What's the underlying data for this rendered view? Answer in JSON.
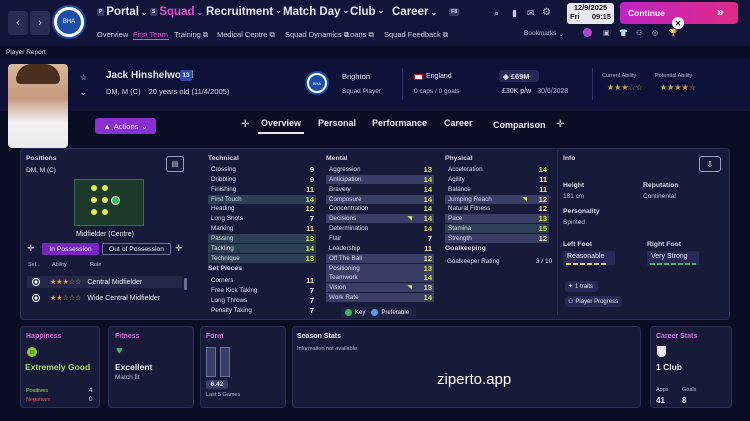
{
  "topbar": {
    "back": "‹",
    "forward": "›",
    "nav": [
      {
        "key": "P",
        "label": "Portal"
      },
      {
        "key": "S",
        "label": "Squad"
      },
      {
        "key": "",
        "label": "Recruitment"
      },
      {
        "key": "",
        "label": "Match Day"
      },
      {
        "key": "",
        "label": "Club"
      },
      {
        "key": "F8",
        "label": "Career"
      }
    ],
    "subnav": [
      "Overview",
      "First Team",
      "Training",
      "Medical Centre",
      "Squad Dynamics",
      "Loans",
      "Squad Feedback"
    ],
    "bookmarks": "Bookmarks",
    "date_line1": "12/9/2025",
    "date_day": "Fri",
    "date_time": "09:15",
    "continue_label": "Continue",
    "accent": "#d42aa8"
  },
  "breadcrumb": "Player Report",
  "player": {
    "name": "Jack Hinshelwood",
    "number": "13",
    "position": "DM, M (C)",
    "age": "20 years old (11/4/2005)",
    "club": "Brighton",
    "status": "Squad Player",
    "nation": "England",
    "caps": "0 caps / 0 goals",
    "value": "£69M",
    "wage": "£30K p/w",
    "contract": "30/6/2028",
    "current_ability_label": "Current Ability",
    "potential_ability_label": "Potential Ability",
    "current_stars": "★★★☆☆",
    "potential_stars": "★★★★☆"
  },
  "actions_label": "Actions",
  "tabs": [
    "Overview",
    "Personal",
    "Performance",
    "Career",
    "Comparison"
  ],
  "positions": {
    "title": "Positions",
    "value": "DM, M (C)",
    "pitch_caption": "Midfielder (Centre)",
    "btn_in": "In Possession",
    "btn_out": "Out of Possession",
    "col_sel": "Sel...",
    "col_ability": "Ability",
    "col_role": "Role",
    "roles": [
      {
        "stars": "★★★☆☆",
        "role": "Central Midfielder"
      },
      {
        "stars": "★★☆☆☆",
        "role": "Wide Central Midfielder"
      }
    ]
  },
  "technical": {
    "title": "Technical",
    "rows": [
      {
        "label": "Crossing",
        "value": "9"
      },
      {
        "label": "Dribbling",
        "value": "9"
      },
      {
        "label": "Finishing",
        "value": "11"
      },
      {
        "label": "First Touch",
        "value": "14"
      },
      {
        "label": "Heading",
        "value": "12"
      },
      {
        "label": "Long Shots",
        "value": "7"
      },
      {
        "label": "Marking",
        "value": "11"
      },
      {
        "label": "Passing",
        "value": "13"
      },
      {
        "label": "Tackling",
        "value": "14"
      },
      {
        "label": "Technique",
        "value": "13"
      }
    ]
  },
  "set_pieces": {
    "title": "Set Pieces",
    "rows": [
      {
        "label": "Corners",
        "value": "11"
      },
      {
        "label": "Free Kick Taking",
        "value": "7"
      },
      {
        "label": "Long Throws",
        "value": "7"
      },
      {
        "label": "Penalty Taking",
        "value": "7"
      }
    ]
  },
  "mental": {
    "title": "Mental",
    "rows": [
      {
        "label": "Aggression",
        "value": "13"
      },
      {
        "label": "Anticipation",
        "value": "14"
      },
      {
        "label": "Bravery",
        "value": "14"
      },
      {
        "label": "Composure",
        "value": "14"
      },
      {
        "label": "Concentration",
        "value": "14"
      },
      {
        "label": "Decisions",
        "value": "14"
      },
      {
        "label": "Determination",
        "value": "14"
      },
      {
        "label": "Flair",
        "value": "7"
      },
      {
        "label": "Leadership",
        "value": "11"
      },
      {
        "label": "Off The Ball",
        "value": "12"
      },
      {
        "label": "Positioning",
        "value": "13"
      },
      {
        "label": "Teamwork",
        "value": "14"
      },
      {
        "label": "Vision",
        "value": "13"
      },
      {
        "label": "Work Rate",
        "value": "14"
      }
    ]
  },
  "physical": {
    "title": "Physical",
    "rows": [
      {
        "label": "Acceleration",
        "value": "14"
      },
      {
        "label": "Agility",
        "value": "11"
      },
      {
        "label": "Balance",
        "value": "11"
      },
      {
        "label": "Jumping Reach",
        "value": "12"
      },
      {
        "label": "Natural Fitness",
        "value": "12"
      },
      {
        "label": "Pace",
        "value": "13"
      },
      {
        "label": "Stamina",
        "value": "15"
      },
      {
        "label": "Strength",
        "value": "12"
      }
    ]
  },
  "goalkeeping": {
    "title": "Goalkeeping",
    "label": "Goalkeeper Rating",
    "value": "3 / 10"
  },
  "legend": {
    "key": "Key",
    "preferable": "Preferable"
  },
  "info": {
    "title": "Info",
    "height_label": "Height",
    "height": "181 cm",
    "reputation_label": "Reputation",
    "reputation": "Continental",
    "personality_label": "Personality",
    "personality": "Spirited",
    "left_foot_label": "Left Foot",
    "left_foot": "Reasonable",
    "right_foot_label": "Right Foot",
    "right_foot": "Very Strong",
    "traits": "1 traits",
    "progress": "Player Progress"
  },
  "happiness": {
    "title": "Happiness",
    "value": "Extremely Good",
    "positives_label": "Positives",
    "positives": "4",
    "negatives_label": "Negatives",
    "negatives": "0"
  },
  "fitness": {
    "title": "Fitness",
    "value": "Excellent",
    "sub": "Match fit"
  },
  "form": {
    "title": "Form",
    "rating": "6.42",
    "sub": "Last 5 Games"
  },
  "season": {
    "title": "Season Stats",
    "sub": "Information not available"
  },
  "watermark": "ziperto.app",
  "career": {
    "title": "Career Stats",
    "club": "1 Club",
    "apps_label": "Apps",
    "apps": "41",
    "goals_label": "Goals",
    "goals": "8"
  }
}
